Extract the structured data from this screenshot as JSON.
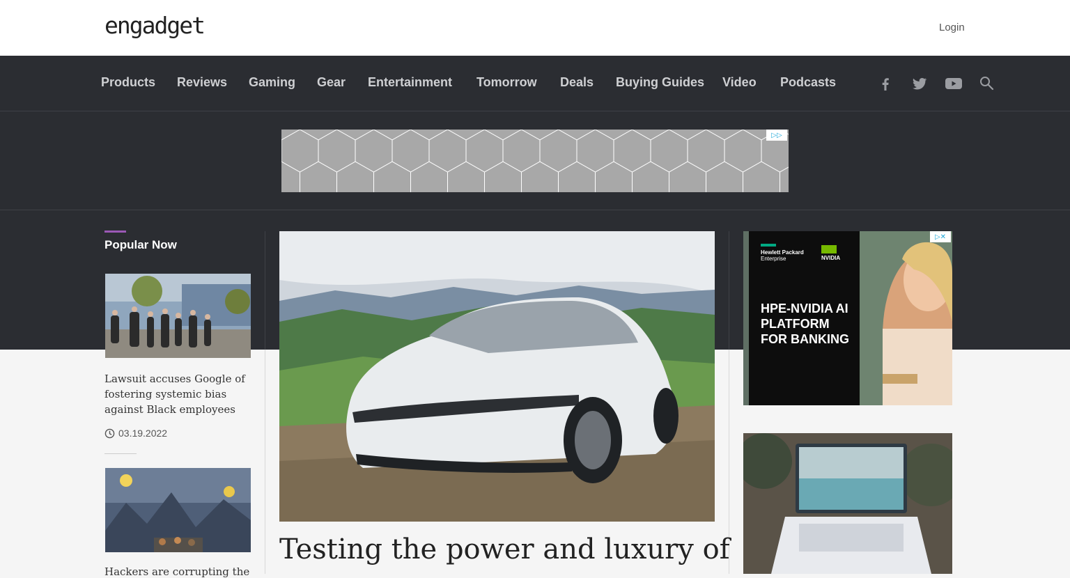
{
  "header": {
    "logo_text": "engadget",
    "login_label": "Login"
  },
  "nav": {
    "items": [
      "Products",
      "Reviews",
      "Gaming",
      "Gear",
      "Entertainment",
      "Tomorrow",
      "Deals",
      "Buying Guides",
      "Video",
      "Podcasts"
    ],
    "icons": [
      "facebook-icon",
      "twitter-icon",
      "youtube-icon",
      "search-icon"
    ]
  },
  "popular": {
    "title": "Popular Now",
    "articles": [
      {
        "headline": "Lawsuit accuses Google of fostering systemic bias against Black employees",
        "date": "03.19.2022"
      },
      {
        "headline": "Hackers are corrupting the"
      }
    ]
  },
  "main": {
    "hero_title": "Testing the power and luxury of"
  },
  "ad": {
    "brand_1": "Hewlett Packard",
    "brand_1_sub": "Enterprise",
    "brand_2": "NVIDIA",
    "headline": "HPE-NVIDIA AI PLATFORM FOR BANKING"
  },
  "colors": {
    "dark_band": "#2b2d32",
    "accent": "#9b59b6",
    "nav_text": "#cfd0d3"
  }
}
